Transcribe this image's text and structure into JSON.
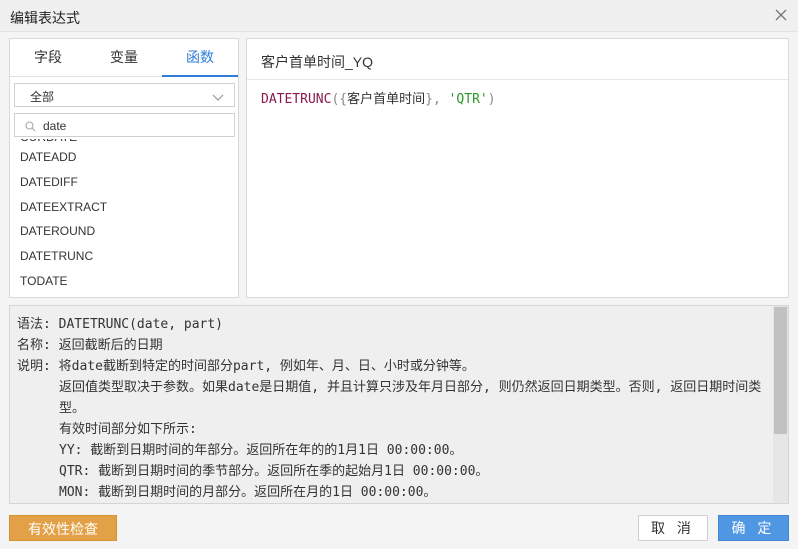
{
  "dialog": {
    "title": "编辑表达式",
    "close_icon": "close-icon"
  },
  "left": {
    "tabs": [
      {
        "label": "字段",
        "active": false
      },
      {
        "label": "变量",
        "active": false
      },
      {
        "label": "函数",
        "active": true
      }
    ],
    "category_select": {
      "value": "全部"
    },
    "search": {
      "value": "date",
      "icon": "search-icon"
    },
    "partial_item": "CURDATE",
    "functions": [
      "DATEADD",
      "DATEDIFF",
      "DATEEXTRACT",
      "DATEROUND",
      "DATETRUNC",
      "TODATE"
    ]
  },
  "editor": {
    "field_name": "客户首单时间_YQ",
    "expression": {
      "fn": "DATETRUNC",
      "open": "({",
      "field": "客户首单时间",
      "mid": "}, ",
      "arg": "'QTR'",
      "close": ")"
    }
  },
  "description": {
    "syntax": "语法: DATETRUNC(date, part)",
    "name": "名称: 返回截断后的日期",
    "explain": "说明: 将date截断到特定的时间部分part, 例如年、月、日、小时或分钟等。",
    "return_type": "返回值类型取决于参数。如果date是日期值, 并且计算只涉及年月日部分, 则仍然返回日期类型。否则, 返回日期时间类型。",
    "valid_parts": "有效时间部分如下所示:",
    "yy": "YY: 截断到日期时间的年部分。返回所在年的的1月1日 00:00:00。",
    "qtr": "QTR: 截断到日期时间的季节部分。返回所在季的起始月1日 00:00:00。",
    "mon": "MON: 截断到日期时间的月部分。返回所在月的1日 00:00:00。"
  },
  "footer": {
    "check_label": "有效性检查",
    "cancel_label": "取 消",
    "ok_label": "确 定"
  },
  "colors": {
    "accent_blue": "#2d7fd9",
    "ok_button": "#4f97e3",
    "check_button": "#e2a146",
    "function_token": "#8a1a4f",
    "string_token": "#2a9a2a"
  }
}
